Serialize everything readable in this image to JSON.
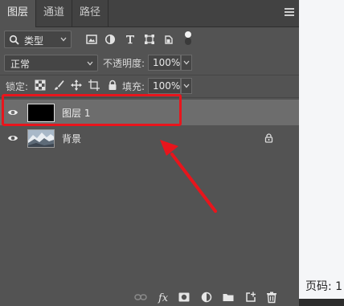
{
  "tabs": [
    {
      "label": "图层",
      "active": true
    },
    {
      "label": "通道",
      "active": false
    },
    {
      "label": "路径",
      "active": false
    }
  ],
  "filter": {
    "label": "类型"
  },
  "blend": {
    "mode": "正常",
    "opacity_label": "不透明度:",
    "opacity_value": "100%"
  },
  "lock": {
    "label": "锁定:",
    "fill_label": "填充:",
    "fill_value": "100%"
  },
  "layers": [
    {
      "name": "图层 1",
      "thumbnail": "black",
      "visible": true,
      "selected": true,
      "locked": false
    },
    {
      "name": "背景",
      "thumbnail": "landscape-photo",
      "visible": true,
      "selected": false,
      "locked": true
    }
  ],
  "annotation": {
    "color": "#e8151c"
  },
  "page_label": "页码: 1",
  "colors": {
    "panel": "#535353",
    "tabbar": "#424242",
    "selected_row": "#6d6d6d",
    "annotation_red": "#e8151c"
  }
}
